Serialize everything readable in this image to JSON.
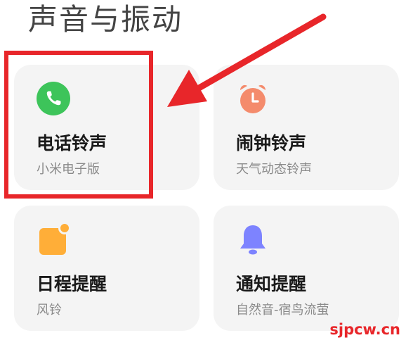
{
  "page": {
    "title": "声音与振动"
  },
  "cards": [
    {
      "title": "电话铃声",
      "subtitle": "小米电子版",
      "icon": "phone-icon",
      "icon_color": "#3dc45a"
    },
    {
      "title": "闹钟铃声",
      "subtitle": "天气动态铃声",
      "icon": "alarm-clock-icon",
      "icon_color": "#f48b6c"
    },
    {
      "title": "日程提醒",
      "subtitle": "风铃",
      "icon": "calendar-reminder-icon",
      "icon_color": "#ffae38"
    },
    {
      "title": "通知提醒",
      "subtitle": "自然音-宿鸟流萤",
      "icon": "bell-icon",
      "icon_color": "#7d83ff"
    }
  ],
  "annotation": {
    "highlight_color": "#e8262a"
  },
  "watermark": {
    "text": "sjpcw.cn"
  }
}
